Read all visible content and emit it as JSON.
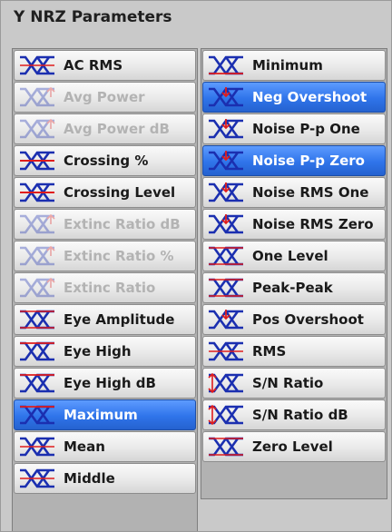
{
  "panel": {
    "title": "Y NRZ Parameters"
  },
  "colors": {
    "selected": "#2f74ea",
    "icon_line": "#1b2fb0",
    "icon_marker": "#e01c1c",
    "disabled_text": "#b3b3b3"
  },
  "left_column": [
    {
      "label": "AC RMS",
      "icon": "eye-rms-icon",
      "state": "normal"
    },
    {
      "label": "Avg Power",
      "icon": "eye-avg-icon",
      "state": "disabled"
    },
    {
      "label": "Avg Power dB",
      "icon": "eye-avg-icon",
      "state": "disabled"
    },
    {
      "label": "Crossing %",
      "icon": "eye-crossing-icon",
      "state": "normal"
    },
    {
      "label": "Crossing Level",
      "icon": "eye-crossing-icon",
      "state": "normal"
    },
    {
      "label": "Extinc Ratio dB",
      "icon": "eye-extinction-icon",
      "state": "disabled"
    },
    {
      "label": "Extinc Ratio %",
      "icon": "eye-extinction-icon",
      "state": "disabled"
    },
    {
      "label": "Extinc Ratio",
      "icon": "eye-extinction-icon",
      "state": "disabled"
    },
    {
      "label": "Eye Amplitude",
      "icon": "eye-amplitude-icon",
      "state": "normal"
    },
    {
      "label": "Eye High",
      "icon": "eye-high-icon",
      "state": "normal"
    },
    {
      "label": "Eye High dB",
      "icon": "eye-high-icon",
      "state": "normal"
    },
    {
      "label": "Maximum",
      "icon": "eye-max-icon",
      "state": "selected"
    },
    {
      "label": "Mean",
      "icon": "eye-mean-icon",
      "state": "normal"
    },
    {
      "label": "Middle",
      "icon": "eye-mean-icon",
      "state": "normal"
    }
  ],
  "right_column": [
    {
      "label": "Minimum",
      "icon": "eye-min-icon",
      "state": "normal"
    },
    {
      "label": "Neg Overshoot",
      "icon": "eye-overshoot-icon",
      "state": "selected"
    },
    {
      "label": "Noise P-p One",
      "icon": "eye-noise-icon",
      "state": "normal"
    },
    {
      "label": "Noise P-p Zero",
      "icon": "eye-noise-icon",
      "state": "selected"
    },
    {
      "label": "Noise RMS One",
      "icon": "eye-noise-icon",
      "state": "normal"
    },
    {
      "label": "Noise RMS Zero",
      "icon": "eye-noise-icon",
      "state": "normal"
    },
    {
      "label": "One Level",
      "icon": "eye-level-icon",
      "state": "normal"
    },
    {
      "label": "Peak-Peak",
      "icon": "eye-peak-icon",
      "state": "normal"
    },
    {
      "label": "Pos Overshoot",
      "icon": "eye-overshoot-icon",
      "state": "normal"
    },
    {
      "label": "RMS",
      "icon": "eye-rms-icon",
      "state": "normal"
    },
    {
      "label": "S/N Ratio",
      "icon": "eye-snr-icon",
      "state": "normal"
    },
    {
      "label": "S/N Ratio dB",
      "icon": "eye-snr-icon",
      "state": "normal"
    },
    {
      "label": "Zero Level",
      "icon": "eye-level-icon",
      "state": "normal"
    }
  ]
}
